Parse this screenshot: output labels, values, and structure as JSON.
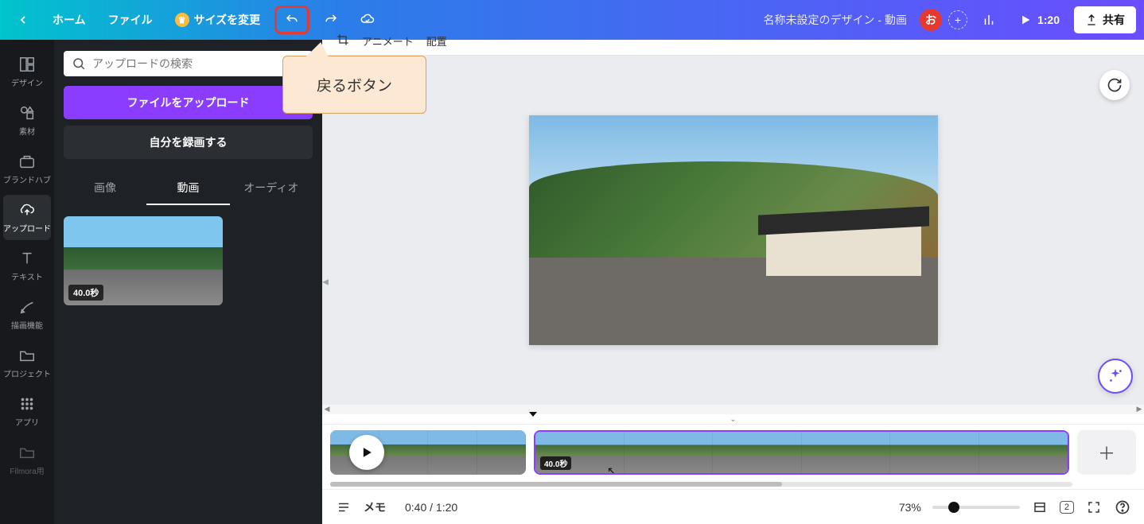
{
  "topbar": {
    "home": "ホーム",
    "file": "ファイル",
    "resize": "サイズを変更",
    "title": "名称未設定のデザイン - 動画",
    "avatar": "お",
    "duration": "1:20",
    "share": "共有"
  },
  "callout": {
    "text": "戻るボタン"
  },
  "rail": {
    "design": "デザイン",
    "elements": "素材",
    "brandhub": "ブランドハブ",
    "upload": "アップロード",
    "text": "テキスト",
    "draw": "描画機能",
    "projects": "プロジェクト",
    "apps": "アプリ",
    "filmora": "Filmora用"
  },
  "panel": {
    "search_placeholder": "アップロードの検索",
    "upload_btn": "ファイルをアップロード",
    "record_btn": "自分を録画する",
    "tab_image": "画像",
    "tab_video": "動画",
    "tab_audio": "オーディオ",
    "thumb_duration": "40.0秒"
  },
  "canvas_toolbar": {
    "animate": "アニメート",
    "position": "配置"
  },
  "timeline": {
    "clip2_duration": "40.0秒"
  },
  "bottom": {
    "memo": "メモ",
    "time": "0:40 / 1:20",
    "zoom": "73%",
    "page_count": "2"
  }
}
